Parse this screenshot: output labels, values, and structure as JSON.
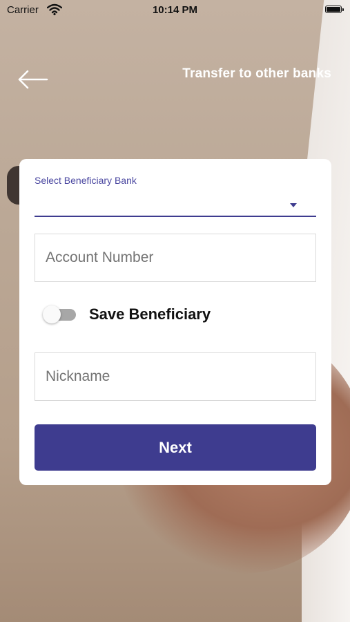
{
  "status_bar": {
    "carrier": "Carrier",
    "time": "10:14 PM",
    "icons": [
      "wifi-icon",
      "battery-icon"
    ]
  },
  "header": {
    "back_icon": "arrow-left-icon",
    "title": "Transfer to other banks"
  },
  "form": {
    "bank_select": {
      "label": "Select Beneficiary Bank",
      "value": "",
      "icon": "chevron-down-icon"
    },
    "account_number": {
      "placeholder": "Account Number",
      "value": ""
    },
    "save_beneficiary": {
      "label": "Save Beneficiary",
      "enabled": false
    },
    "nickname": {
      "placeholder": "Nickname",
      "value": ""
    },
    "next_label": "Next"
  },
  "colors": {
    "accent": "#3e3c8f",
    "underline": "#3e3c8f",
    "card": "#ffffff",
    "toggle_track": "#a7a7a7"
  }
}
